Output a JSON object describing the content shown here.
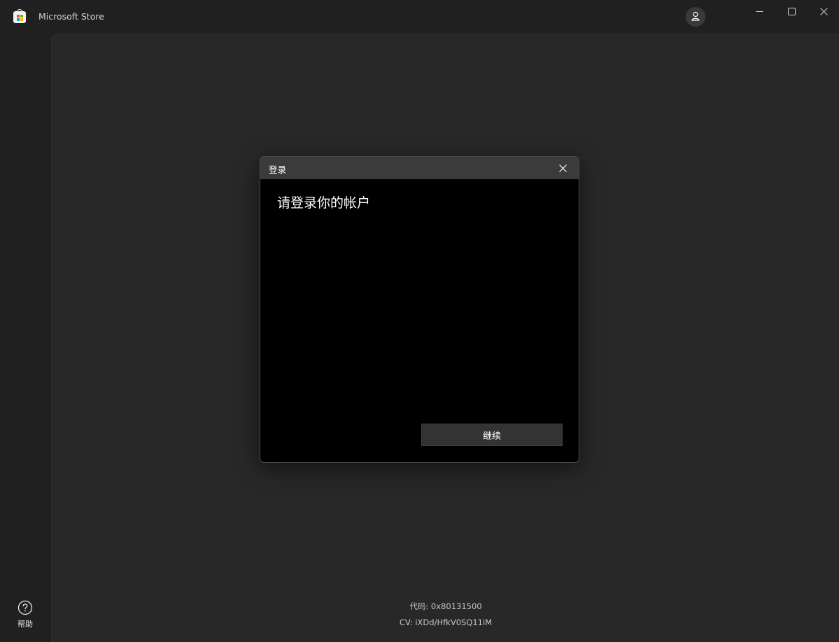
{
  "window": {
    "app_title": "Microsoft Store",
    "icons": {
      "app": "microsoft-store-icon",
      "account": "account-icon",
      "minimize": "minimize-icon",
      "maximize": "maximize-icon",
      "close": "close-icon"
    }
  },
  "sidebar": {
    "help_label": "帮助",
    "help_icon": "help-circle-icon"
  },
  "dialog": {
    "title": "登录",
    "heading": "请登录你的帐户",
    "continue_label": "继续",
    "close_icon": "close-icon"
  },
  "error": {
    "code_line": "代码: 0x80131500",
    "cv_line": "CV: iXDd/HfkV0SQ11iM"
  },
  "colors": {
    "window_bg": "#202020",
    "content_bg": "#282828",
    "dialog_bg": "#000000",
    "dialog_titlebar_bg": "#3b3b3b",
    "button_bg": "#333333"
  }
}
